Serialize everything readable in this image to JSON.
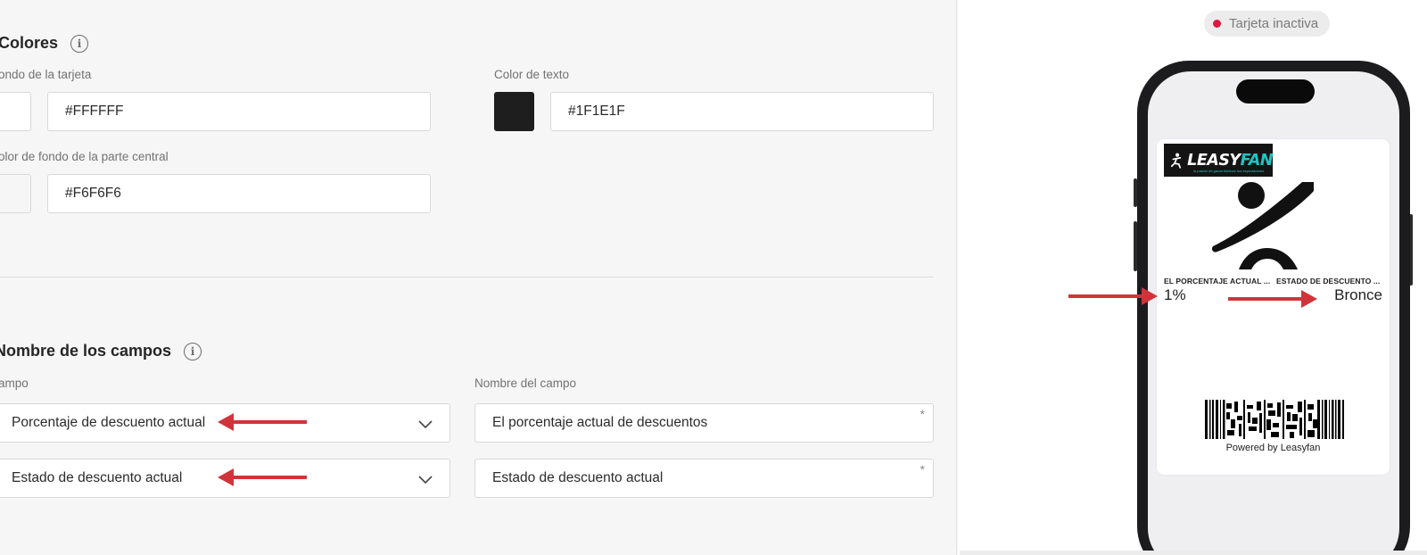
{
  "colores": {
    "title": "Colores",
    "card_bg_label": "ondo de la tarjeta",
    "card_bg_value": "#FFFFFF",
    "card_bg_color": "#FFFFFF",
    "text_color_label": "Color de texto",
    "text_color_value": "#1F1E1F",
    "text_color_color": "#1F1E1F",
    "center_bg_label": "olor de fondo de la parte central",
    "center_bg_value": "#F6F6F6",
    "center_bg_color": "#F6F6F6"
  },
  "campos": {
    "title": "Nombre de los campos",
    "field_label": "ampo",
    "field_name_label": "Nombre del campo",
    "rows": [
      {
        "field": "Porcentaje de descuento actual",
        "name": "El porcentaje actual de descuentos"
      },
      {
        "field": "Estado de descuento actual",
        "name": "Estado de descuento actual"
      }
    ],
    "required_mark": "*"
  },
  "preview": {
    "status": "Tarjeta inactiva",
    "status_color": "#E0173F",
    "logo_main": "LEASY",
    "logo_accent": "FAN",
    "logo_tagline": "la pasión de ganar fidelizar tus espectadores",
    "brand_color": "#21C4C3",
    "field1_label": "EL PORCENTAJE ACTUAL ...",
    "field1_value": "1%",
    "field2_label": "ESTADO DE DESCUENTO ...",
    "field2_value": "Bronce",
    "powered_by": "Powered by Leasyfan"
  },
  "annotations": {
    "arrow_color": "#D0343A"
  }
}
